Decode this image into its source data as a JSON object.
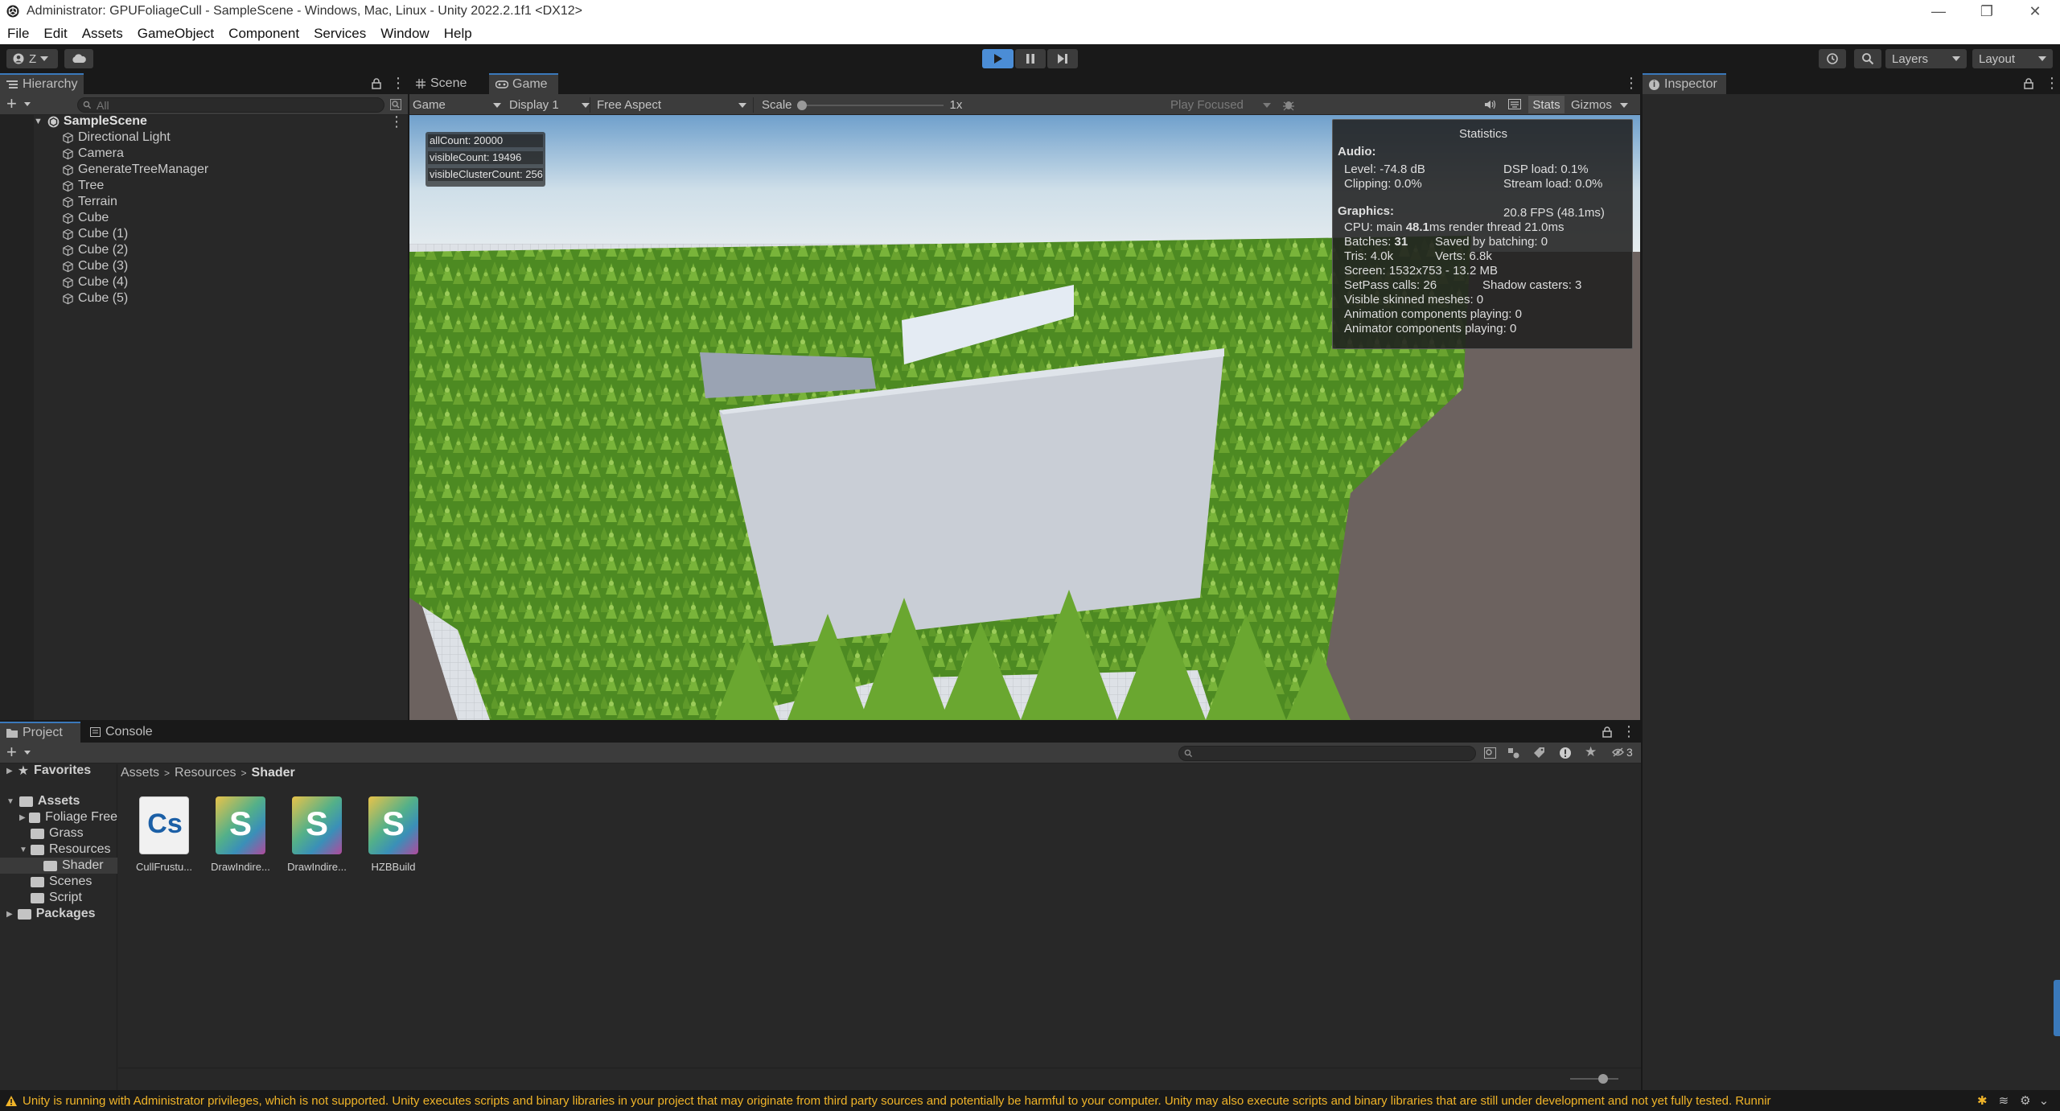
{
  "window": {
    "title": "Administrator: GPUFoliageCull - SampleScene - Windows, Mac, Linux - Unity 2022.2.1f1 <DX12>",
    "controls": [
      "—",
      "❐",
      "✕"
    ]
  },
  "menu": [
    "File",
    "Edit",
    "Assets",
    "GameObject",
    "Component",
    "Services",
    "Window",
    "Help"
  ],
  "toolbar": {
    "account": "Z",
    "layers_label": "Layers",
    "layout_label": "Layout",
    "play_color": "#4b8dd6"
  },
  "hierarchy": {
    "tab": "Hierarchy",
    "search_placeholder": "All",
    "scene": "SampleScene",
    "items": [
      "Directional Light",
      "Camera",
      "GenerateTreeManager",
      "Tree",
      "Terrain",
      "Cube",
      "Cube (1)",
      "Cube (2)",
      "Cube (3)",
      "Cube (4)",
      "Cube (5)"
    ]
  },
  "game": {
    "tabs": [
      "Scene",
      "Game"
    ],
    "view_mode": "Game",
    "display": "Display 1",
    "aspect": "Free Aspect",
    "scale_label": "Scale",
    "scale_value": "1x",
    "play_focused": "Play Focused",
    "stats_btn": "Stats",
    "gizmos_btn": "Gizmos",
    "overlay": [
      "allCount: 20000",
      "visibleCount: 19496",
      "visibleClusterCount: 256"
    ]
  },
  "stats": {
    "title": "Statistics",
    "audio_label": "Audio:",
    "level": "Level: -74.8 dB",
    "clipping": "Clipping: 0.0%",
    "dsp": "DSP load: 0.1%",
    "stream": "Stream load: 0.0%",
    "graphics_label": "Graphics:",
    "fps": "20.8 FPS (48.1ms)",
    "cpu_prefix": "CPU: main ",
    "cpu_main": "48.1",
    "cpu_suffix": "ms  render thread 21.0ms",
    "batches_prefix": "Batches: ",
    "batches": "31",
    "saved": "Saved by batching: 0",
    "tris": "Tris: 4.0k",
    "verts": "Verts: 6.8k",
    "screen": "Screen: 1532x753 - 13.2 MB",
    "setpass": "SetPass calls: 26",
    "shadow": "Shadow casters: 3",
    "skinned": "Visible skinned meshes: 0",
    "anim": "Animation components playing: 0",
    "animator": "Animator components playing: 0"
  },
  "inspector": {
    "tab": "Inspector"
  },
  "project": {
    "tabs": [
      "Project",
      "Console"
    ],
    "favorites": "Favorites",
    "assets": "Assets",
    "folders": [
      "Foliage Free",
      "Grass",
      "Resources",
      "Shader",
      "Scenes",
      "Script"
    ],
    "packages": "Packages",
    "breadcrumb": [
      "Assets",
      "Resources",
      "Shader"
    ],
    "hidden_count": "3",
    "files": [
      {
        "label": "CullFrustu...",
        "icon": "Cs"
      },
      {
        "label": "DrawIndire...",
        "icon": "S"
      },
      {
        "label": "DrawIndire...",
        "icon": "S"
      },
      {
        "label": "HZBBuild",
        "icon": "S"
      }
    ]
  },
  "status": {
    "message": "Unity is running with Administrator privileges, which is not supported. Unity executes scripts and binary libraries in your project that may originate from third party sources and potentially be harmful to your computer. Unity may also execute scripts and binary libraries that are still under development and not yet fully tested. Runnir"
  }
}
